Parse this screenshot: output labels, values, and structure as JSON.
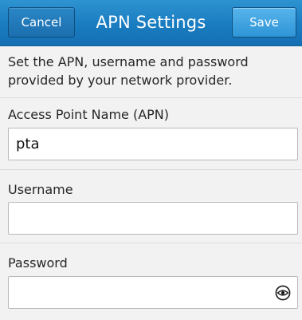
{
  "header": {
    "title": "APN Settings",
    "cancel_label": "Cancel",
    "save_label": "Save"
  },
  "instructions": "Set the APN, username and password provided by your network provider.",
  "fields": {
    "apn": {
      "label": "Access Point Name (APN)",
      "value": "pta"
    },
    "username": {
      "label": "Username",
      "value": ""
    },
    "password": {
      "label": "Password",
      "value": "",
      "reveal_icon": "eye-icon"
    }
  },
  "colors": {
    "header_blue": "#1a7cc0",
    "save_button_blue": "#3a9fdf",
    "background": "#f2f2f2"
  }
}
